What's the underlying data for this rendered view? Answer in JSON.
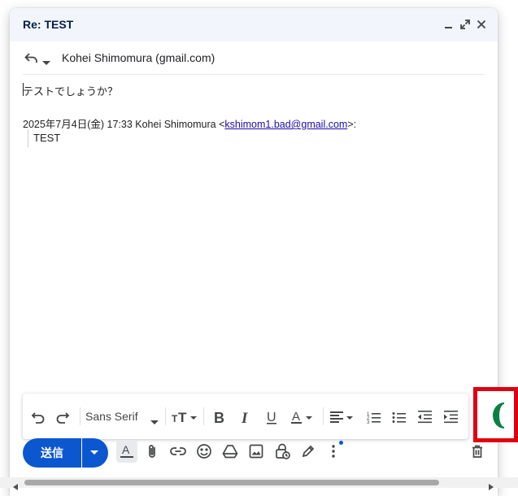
{
  "window": {
    "title": "Re: TEST",
    "controls": [
      "minimize-icon",
      "expand-icon",
      "close-icon"
    ]
  },
  "recipient": {
    "name": "Kohei Shimomura (gmail.com)",
    "reply_icon": "reply-icon",
    "reply_menu_icon": "chevron-down-icon"
  },
  "body": {
    "text": "テストでしょうか？",
    "quote_header_prefix": "2025年7月4日(金) 17:33 Kohei Shimomura <",
    "quote_email": "kshimom1.bad@gmail.com",
    "quote_header_suffix": ">:",
    "quote_text": "TEST"
  },
  "formatting_toolbar": {
    "font": "Sans Serif",
    "items": [
      "undo-icon",
      "redo-icon",
      "font-family-select",
      "font-size-icon",
      "bold-icon",
      "italic-icon",
      "underline-icon",
      "text-color-icon",
      "align-icon",
      "numbered-list-icon",
      "bulleted-list-icon",
      "indent-less-icon",
      "indent-more-icon"
    ]
  },
  "bottom_toolbar": {
    "send_label": "送信",
    "items": [
      "formatting-options-icon",
      "attach-icon",
      "link-icon",
      "emoji-icon",
      "drive-icon",
      "photo-icon",
      "confidential-mode-icon",
      "signature-icon",
      "more-options-icon",
      "trash-icon"
    ]
  },
  "colors": {
    "accent": "#0b57d0",
    "title_bar": "#f2f6fc",
    "highlight": "#e00010",
    "link": "#1a0dab"
  }
}
